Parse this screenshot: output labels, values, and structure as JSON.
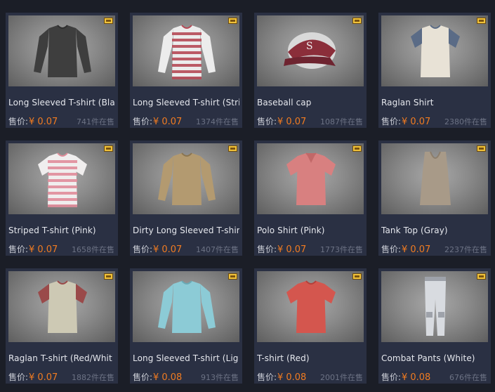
{
  "market": {
    "price_label": "售价:",
    "currency": "¥",
    "items": [
      {
        "name": "Long Sleeved T-shirt (Bla",
        "price": "0.07",
        "stock": "741件在售",
        "icon": "shirt-icon",
        "color": "#3e3e3e",
        "accent": "#2f2f2f",
        "kind": "longsleeve"
      },
      {
        "name": "Long Sleeved T-shirt (Stri",
        "price": "0.07",
        "stock": "1374件在售",
        "icon": "shirt-icon",
        "color": "#ececec",
        "accent": "#b64a56",
        "kind": "longsleeve-striped"
      },
      {
        "name": "Baseball cap",
        "price": "0.07",
        "stock": "1087件在售",
        "icon": "cap-icon",
        "color": "#8b2e3a",
        "accent": "#d9d9d9",
        "kind": "cap"
      },
      {
        "name": "Raglan Shirt",
        "price": "0.07",
        "stock": "2380件在售",
        "icon": "shirt-icon",
        "color": "#e8e2d6",
        "accent": "#5a6b86",
        "kind": "raglan"
      },
      {
        "name": "Striped T-shirt (Pink)",
        "price": "0.07",
        "stock": "1658件在售",
        "icon": "shirt-icon",
        "color": "#f0eeee",
        "accent": "#e08c9a",
        "kind": "tee-striped"
      },
      {
        "name": "Dirty Long Sleeved T-shir",
        "price": "0.07",
        "stock": "1407件在售",
        "icon": "shirt-icon",
        "color": "#b39a70",
        "accent": "#8b7550",
        "kind": "longsleeve"
      },
      {
        "name": "Polo Shirt (Pink)",
        "price": "0.07",
        "stock": "1773件在售",
        "icon": "shirt-icon",
        "color": "#d88080",
        "accent": "#c26868",
        "kind": "polo"
      },
      {
        "name": "Tank Top (Gray)",
        "price": "0.07",
        "stock": "2237件在售",
        "icon": "shirt-icon",
        "color": "#a89a88",
        "accent": "#8c7e6c",
        "kind": "tank"
      },
      {
        "name": "Raglan T-shirt (Red/Whit",
        "price": "0.07",
        "stock": "1882件在售",
        "icon": "shirt-icon",
        "color": "#cdc9b4",
        "accent": "#9a4a4a",
        "kind": "raglan"
      },
      {
        "name": "Long Sleeved T-shirt (Lig",
        "price": "0.08",
        "stock": "913件在售",
        "icon": "shirt-icon",
        "color": "#8ccbd6",
        "accent": "#6aaab6",
        "kind": "longsleeve"
      },
      {
        "name": "T-shirt (Red)",
        "price": "0.08",
        "stock": "2001件在售",
        "icon": "shirt-icon",
        "color": "#d4564e",
        "accent": "#b4403a",
        "kind": "tee"
      },
      {
        "name": "Combat Pants (White)",
        "price": "0.08",
        "stock": "676件在售",
        "icon": "pants-icon",
        "color": "#d8dbe0",
        "accent": "#9ea2aa",
        "kind": "pants"
      }
    ]
  }
}
